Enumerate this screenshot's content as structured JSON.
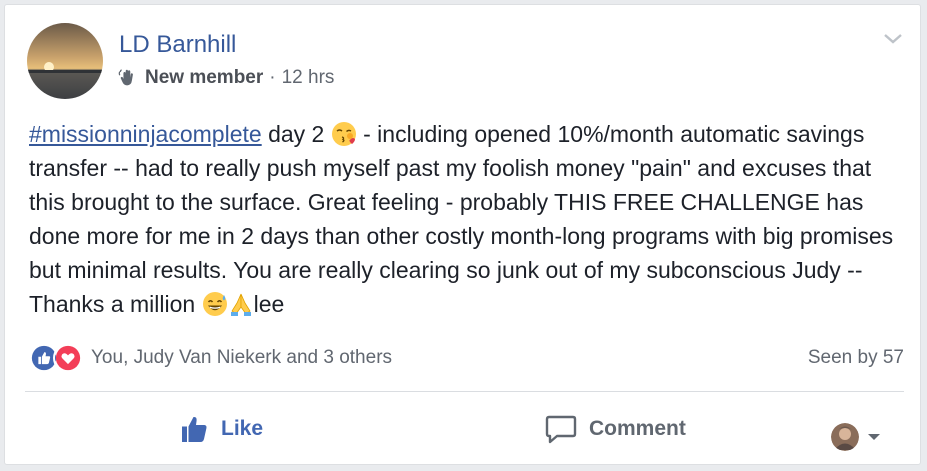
{
  "post": {
    "author": "LD Barnhill",
    "badge": "New member",
    "separator": "·",
    "timestamp": "12 hrs",
    "hashtag": "#missionninjacomplete",
    "text_after_hashtag": " day 2 ",
    "text_main": " - including opened 10%/month automatic savings transfer -- had to really push myself past my foolish money \"pain\" and excuses that this brought to the surface. Great feeling - probably THIS FREE CHALLENGE has done more for me in 2 days than other costly month-long programs with big promises but minimal results. You are really clearing so junk out of my subconscious Judy -- Thanks a million ",
    "text_end": "lee"
  },
  "reactions": {
    "names": "You, Judy Van Niekerk and 3 others",
    "seen": "Seen by 57"
  },
  "actions": {
    "like": "Like",
    "comment": "Comment"
  },
  "icons": {
    "badge": "wave-hand-icon",
    "emoji1": "kissing-face-icon",
    "emoji2": "grinning-sweat-face-icon",
    "emoji3": "folded-hands-icon"
  },
  "colors": {
    "link": "#365899",
    "like_blue": "#4267b2",
    "love_red": "#f33e58"
  }
}
